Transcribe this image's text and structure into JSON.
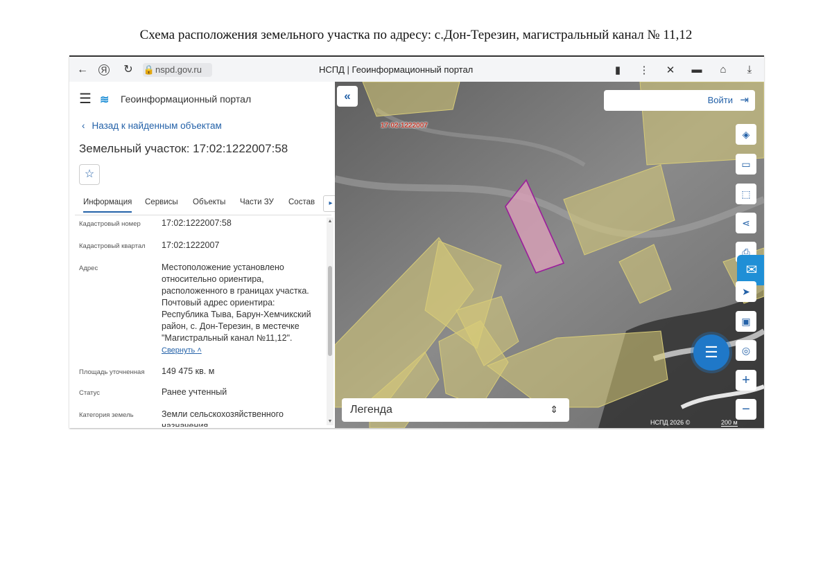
{
  "document_title": "Схема расположения земельного участка по адресу: с.Дон-Терезин, магистральный канал № 11,12",
  "browser": {
    "url": "nspd.gov.ru",
    "tab_title": "НСПД | Геоинформационный портал",
    "icons": [
      "back-arrow-icon",
      "yandex-icon",
      "reload-icon",
      "lock-icon",
      "bookmark-icon",
      "menu-dots-icon",
      "extension-icon",
      "shield-icon",
      "clipboard-icon",
      "download-icon"
    ]
  },
  "sidebar": {
    "app_name": "Геоинформационный портал",
    "back_link": "Назад к найденным объектам",
    "parcel_title": "Земельный участок: 17:02:1222007:58",
    "tabs": [
      "Информация",
      "Сервисы",
      "Объекты",
      "Части ЗУ",
      "Состав"
    ],
    "active_tab": "Информация",
    "rows": [
      {
        "label": "Кадастровый номер",
        "value": "17:02:1222007:58"
      },
      {
        "label": "Кадастровый квартал",
        "value": "17:02:1222007"
      },
      {
        "label": "Адрес",
        "value": "Местоположение установлено относительно ориентира, расположенного в границах участка. Почтовый адрес ориентира: Республика Тыва, Барун-Хемчикский район, с. Дон-Терезин, в местечке \"Магистральный канал №11,12\"."
      },
      {
        "label": "Площадь уточненная",
        "value": "149 475 кв. м"
      },
      {
        "label": "Статус",
        "value": "Ранее учтенный"
      },
      {
        "label": "Категория земель",
        "value": "Земли сельскохозяйственного назначения"
      }
    ],
    "collapse_label": "Свернуть"
  },
  "map": {
    "login_label": "Войти",
    "cadastral_label": "17:02:1222007",
    "legend_label": "Легенда",
    "copyright": "НСПД 2026 ©",
    "scale": "200 м",
    "tools": [
      "layers-icon",
      "ruler-icon",
      "area-select-icon",
      "share-icon",
      "print-icon",
      "locate-icon",
      "screen-icon",
      "geo-pin-icon",
      "zoom-in-icon",
      "zoom-out-icon"
    ],
    "colors": {
      "parcel_fill": "#d8cc78",
      "selected_fill": "#d9a0b8",
      "selected_stroke": "#9b1d9b",
      "accent": "#2361a8"
    }
  }
}
